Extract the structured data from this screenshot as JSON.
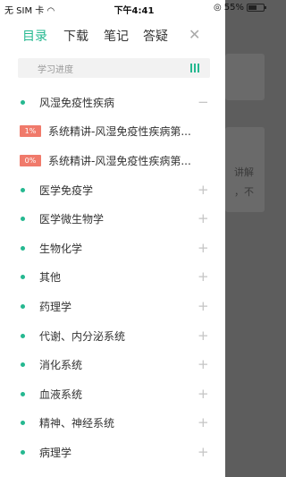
{
  "status_bar": {
    "carrier": "无 SIM 卡",
    "time": "下午4:41",
    "battery": "55%",
    "battery_level": 0.55
  },
  "background": {
    "snippet_1": "讲解",
    "snippet_2": "，不"
  },
  "drawer": {
    "tabs": [
      "目录",
      "下载",
      "笔记",
      "答疑"
    ],
    "active_tab": "目录",
    "close_icon": "close-icon",
    "progress_label": "学习进度",
    "progress_icon": "bars-icon",
    "accent_color": "#25b890",
    "badge_color": "#f07a6b"
  },
  "chapters": [
    {
      "label": "风湿免疫性疾病",
      "action": "−",
      "expanded": true
    },
    {
      "label": "系统精讲-风湿免疫性疾病第...",
      "badge": "1%",
      "sub": true
    },
    {
      "label": "系统精讲-风湿免疫性疾病第...",
      "badge": "0%",
      "sub": true
    },
    {
      "label": "医学免疫学",
      "action": "+"
    },
    {
      "label": "医学微生物学",
      "action": "+"
    },
    {
      "label": "生物化学",
      "action": "+"
    },
    {
      "label": "其他",
      "action": "+"
    },
    {
      "label": "药理学",
      "action": "+"
    },
    {
      "label": "代谢、内分泌系统",
      "action": "+"
    },
    {
      "label": "消化系统",
      "action": "+"
    },
    {
      "label": "血液系统",
      "action": "+"
    },
    {
      "label": "精神、神经系统",
      "action": "+"
    },
    {
      "label": "病理学",
      "action": "+"
    }
  ]
}
